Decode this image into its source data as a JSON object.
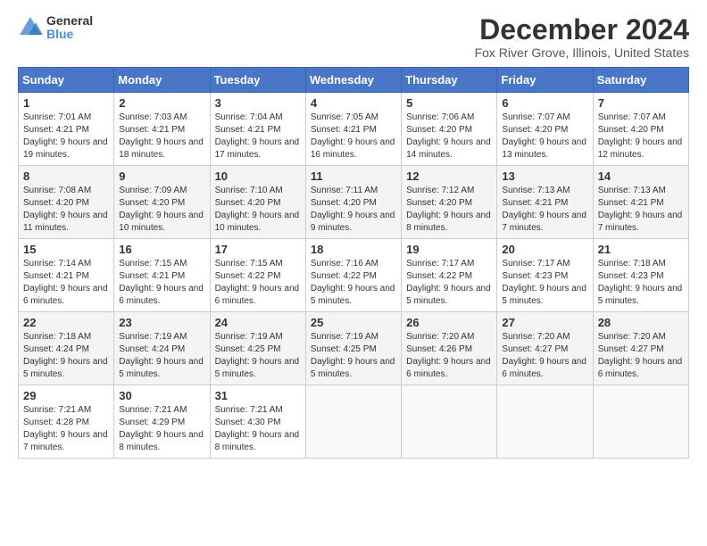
{
  "logo": {
    "general": "General",
    "blue": "Blue"
  },
  "title": "December 2024",
  "subtitle": "Fox River Grove, Illinois, United States",
  "headers": [
    "Sunday",
    "Monday",
    "Tuesday",
    "Wednesday",
    "Thursday",
    "Friday",
    "Saturday"
  ],
  "weeks": [
    [
      {
        "day": "1",
        "sunrise": "Sunrise: 7:01 AM",
        "sunset": "Sunset: 4:21 PM",
        "daylight": "Daylight: 9 hours and 19 minutes."
      },
      {
        "day": "2",
        "sunrise": "Sunrise: 7:03 AM",
        "sunset": "Sunset: 4:21 PM",
        "daylight": "Daylight: 9 hours and 18 minutes."
      },
      {
        "day": "3",
        "sunrise": "Sunrise: 7:04 AM",
        "sunset": "Sunset: 4:21 PM",
        "daylight": "Daylight: 9 hours and 17 minutes."
      },
      {
        "day": "4",
        "sunrise": "Sunrise: 7:05 AM",
        "sunset": "Sunset: 4:21 PM",
        "daylight": "Daylight: 9 hours and 16 minutes."
      },
      {
        "day": "5",
        "sunrise": "Sunrise: 7:06 AM",
        "sunset": "Sunset: 4:20 PM",
        "daylight": "Daylight: 9 hours and 14 minutes."
      },
      {
        "day": "6",
        "sunrise": "Sunrise: 7:07 AM",
        "sunset": "Sunset: 4:20 PM",
        "daylight": "Daylight: 9 hours and 13 minutes."
      },
      {
        "day": "7",
        "sunrise": "Sunrise: 7:07 AM",
        "sunset": "Sunset: 4:20 PM",
        "daylight": "Daylight: 9 hours and 12 minutes."
      }
    ],
    [
      {
        "day": "8",
        "sunrise": "Sunrise: 7:08 AM",
        "sunset": "Sunset: 4:20 PM",
        "daylight": "Daylight: 9 hours and 11 minutes."
      },
      {
        "day": "9",
        "sunrise": "Sunrise: 7:09 AM",
        "sunset": "Sunset: 4:20 PM",
        "daylight": "Daylight: 9 hours and 10 minutes."
      },
      {
        "day": "10",
        "sunrise": "Sunrise: 7:10 AM",
        "sunset": "Sunset: 4:20 PM",
        "daylight": "Daylight: 9 hours and 10 minutes."
      },
      {
        "day": "11",
        "sunrise": "Sunrise: 7:11 AM",
        "sunset": "Sunset: 4:20 PM",
        "daylight": "Daylight: 9 hours and 9 minutes."
      },
      {
        "day": "12",
        "sunrise": "Sunrise: 7:12 AM",
        "sunset": "Sunset: 4:20 PM",
        "daylight": "Daylight: 9 hours and 8 minutes."
      },
      {
        "day": "13",
        "sunrise": "Sunrise: 7:13 AM",
        "sunset": "Sunset: 4:21 PM",
        "daylight": "Daylight: 9 hours and 7 minutes."
      },
      {
        "day": "14",
        "sunrise": "Sunrise: 7:13 AM",
        "sunset": "Sunset: 4:21 PM",
        "daylight": "Daylight: 9 hours and 7 minutes."
      }
    ],
    [
      {
        "day": "15",
        "sunrise": "Sunrise: 7:14 AM",
        "sunset": "Sunset: 4:21 PM",
        "daylight": "Daylight: 9 hours and 6 minutes."
      },
      {
        "day": "16",
        "sunrise": "Sunrise: 7:15 AM",
        "sunset": "Sunset: 4:21 PM",
        "daylight": "Daylight: 9 hours and 6 minutes."
      },
      {
        "day": "17",
        "sunrise": "Sunrise: 7:15 AM",
        "sunset": "Sunset: 4:22 PM",
        "daylight": "Daylight: 9 hours and 6 minutes."
      },
      {
        "day": "18",
        "sunrise": "Sunrise: 7:16 AM",
        "sunset": "Sunset: 4:22 PM",
        "daylight": "Daylight: 9 hours and 5 minutes."
      },
      {
        "day": "19",
        "sunrise": "Sunrise: 7:17 AM",
        "sunset": "Sunset: 4:22 PM",
        "daylight": "Daylight: 9 hours and 5 minutes."
      },
      {
        "day": "20",
        "sunrise": "Sunrise: 7:17 AM",
        "sunset": "Sunset: 4:23 PM",
        "daylight": "Daylight: 9 hours and 5 minutes."
      },
      {
        "day": "21",
        "sunrise": "Sunrise: 7:18 AM",
        "sunset": "Sunset: 4:23 PM",
        "daylight": "Daylight: 9 hours and 5 minutes."
      }
    ],
    [
      {
        "day": "22",
        "sunrise": "Sunrise: 7:18 AM",
        "sunset": "Sunset: 4:24 PM",
        "daylight": "Daylight: 9 hours and 5 minutes."
      },
      {
        "day": "23",
        "sunrise": "Sunrise: 7:19 AM",
        "sunset": "Sunset: 4:24 PM",
        "daylight": "Daylight: 9 hours and 5 minutes."
      },
      {
        "day": "24",
        "sunrise": "Sunrise: 7:19 AM",
        "sunset": "Sunset: 4:25 PM",
        "daylight": "Daylight: 9 hours and 5 minutes."
      },
      {
        "day": "25",
        "sunrise": "Sunrise: 7:19 AM",
        "sunset": "Sunset: 4:25 PM",
        "daylight": "Daylight: 9 hours and 5 minutes."
      },
      {
        "day": "26",
        "sunrise": "Sunrise: 7:20 AM",
        "sunset": "Sunset: 4:26 PM",
        "daylight": "Daylight: 9 hours and 6 minutes."
      },
      {
        "day": "27",
        "sunrise": "Sunrise: 7:20 AM",
        "sunset": "Sunset: 4:27 PM",
        "daylight": "Daylight: 9 hours and 6 minutes."
      },
      {
        "day": "28",
        "sunrise": "Sunrise: 7:20 AM",
        "sunset": "Sunset: 4:27 PM",
        "daylight": "Daylight: 9 hours and 6 minutes."
      }
    ],
    [
      {
        "day": "29",
        "sunrise": "Sunrise: 7:21 AM",
        "sunset": "Sunset: 4:28 PM",
        "daylight": "Daylight: 9 hours and 7 minutes."
      },
      {
        "day": "30",
        "sunrise": "Sunrise: 7:21 AM",
        "sunset": "Sunset: 4:29 PM",
        "daylight": "Daylight: 9 hours and 8 minutes."
      },
      {
        "day": "31",
        "sunrise": "Sunrise: 7:21 AM",
        "sunset": "Sunset: 4:30 PM",
        "daylight": "Daylight: 9 hours and 8 minutes."
      },
      null,
      null,
      null,
      null
    ]
  ]
}
